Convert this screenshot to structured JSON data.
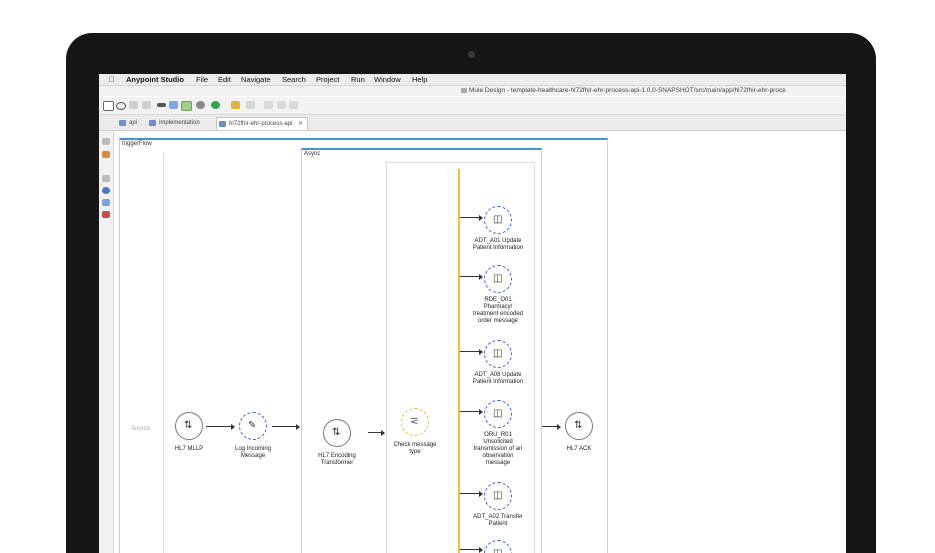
{
  "menubar": {
    "app_name": "Anypoint Studio",
    "items": [
      "File",
      "Edit",
      "Navigate",
      "Search",
      "Project",
      "Run",
      "Window",
      "Help"
    ]
  },
  "window": {
    "title": "Mule Design - template-healthcare-hl72fhir-ehr-process-api-1.0.0-SNAPSHOT/src/main/app/hl72fhir-ehr-proce"
  },
  "tabs": [
    {
      "label": "api"
    },
    {
      "label": "implementation"
    },
    {
      "label": "hl72fhir-ehr-process-api"
    }
  ],
  "flow": {
    "name": "triggerFlow",
    "source_label": "Source",
    "async_label": "Async",
    "nodes": {
      "mllp": "HL7 MLLP",
      "log_l1": "Log Incoming",
      "log_l2": "Message",
      "enc_l1": "HL7 Encoding",
      "enc_l2": "Transformer",
      "choice_l1": "Check message",
      "choice_l2": "type",
      "ack": "HL7 ACK"
    },
    "routes": [
      {
        "lines": [
          "ADT_A01 Update",
          "Patient Information"
        ]
      },
      {
        "lines": [
          "RDE_O01",
          "Pharmacy/",
          "treatment encoded",
          "order message"
        ]
      },
      {
        "lines": [
          "ADT_A08 Update",
          "Patient Information"
        ]
      },
      {
        "lines": [
          "ORU_R01",
          "Unsolicited",
          "transmission of an",
          "observation",
          "message"
        ]
      },
      {
        "lines": [
          "ADT_A02 Transfer",
          "Patient"
        ]
      }
    ]
  },
  "colors": {
    "accent_blue": "#3d5bd6",
    "choice_gold": "#f2bf2b",
    "header_blue": "#4a90d9"
  },
  "icons": {
    "apple": "apple-icon",
    "listener": "sync-listener-icon",
    "logger": "pencil-icon",
    "transformer": "transform-icon",
    "choice": "choice-router-icon",
    "flow_ref": "flow-reference-icon"
  }
}
